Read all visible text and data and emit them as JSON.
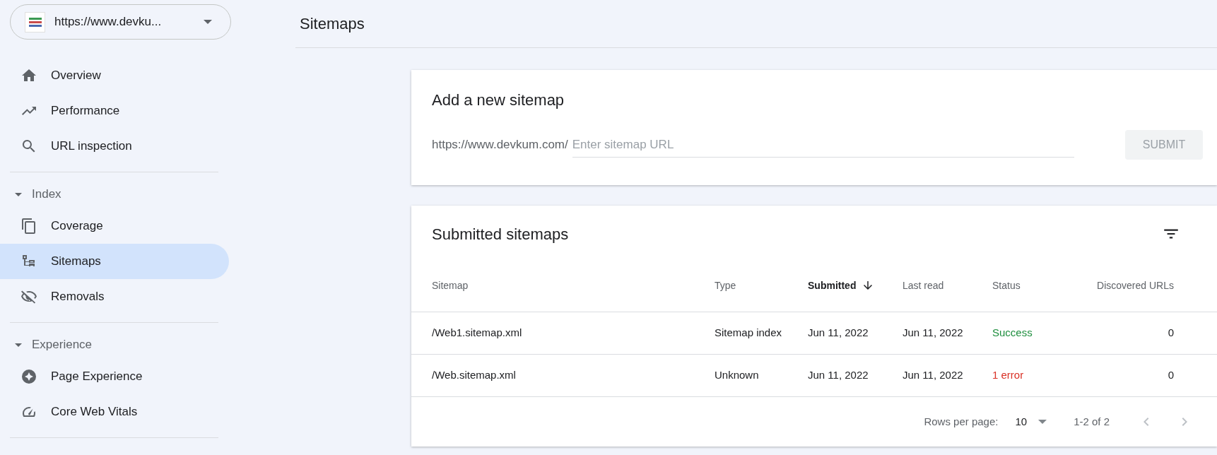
{
  "property_selector": {
    "label": "https://www.devku..."
  },
  "sidebar": {
    "items": [
      {
        "kind": "link",
        "label": "Overview",
        "selected": false
      },
      {
        "kind": "link",
        "label": "Performance",
        "selected": false
      },
      {
        "kind": "link",
        "label": "URL inspection",
        "selected": false
      }
    ],
    "sections": [
      {
        "label": "Index",
        "expanded": true,
        "items": [
          {
            "label": "Coverage",
            "selected": false
          },
          {
            "label": "Sitemaps",
            "selected": true
          },
          {
            "label": "Removals",
            "selected": false
          }
        ]
      },
      {
        "label": "Experience",
        "expanded": true,
        "items": [
          {
            "label": "Page Experience",
            "selected": false
          },
          {
            "label": "Core Web Vitals",
            "selected": false
          }
        ]
      }
    ]
  },
  "page_title": "Sitemaps",
  "add_sitemap": {
    "title": "Add a new sitemap",
    "prefix": "https://www.devkum.com/",
    "placeholder": "Enter sitemap URL",
    "button": "SUBMIT",
    "disabled": true
  },
  "submitted": {
    "title": "Submitted sitemaps",
    "columns": [
      {
        "label": "Sitemap",
        "sorted": false
      },
      {
        "label": "Type",
        "sorted": false
      },
      {
        "label": "Submitted",
        "sorted": true
      },
      {
        "label": "Last read",
        "sorted": false
      },
      {
        "label": "Status",
        "sorted": false
      },
      {
        "label": "Discovered URLs",
        "sorted": false
      }
    ],
    "rows": [
      {
        "sitemap": "/Web1.sitemap.xml",
        "type": "Sitemap index",
        "submitted": "Jun 11, 2022",
        "last_read": "Jun 11, 2022",
        "status": "Success",
        "color": "#1e8e3e",
        "discovered": "0"
      },
      {
        "sitemap": "/Web.sitemap.xml",
        "type": "Unknown",
        "submitted": "Jun 11, 2022",
        "last_read": "Jun 11, 2022",
        "status": "1 error",
        "color": "#d93025",
        "discovered": "0"
      }
    ],
    "pagination": {
      "rows_label": "Rows per page:",
      "rows_value": "10",
      "range": "1-2 of 2"
    }
  }
}
